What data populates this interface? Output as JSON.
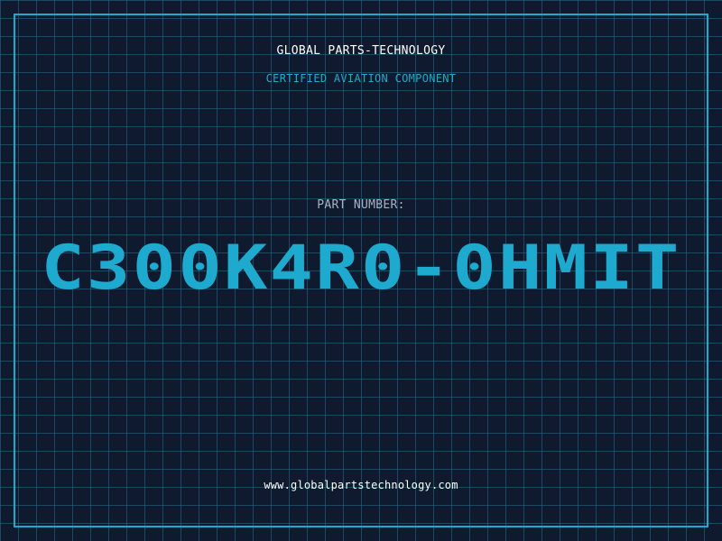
{
  "header": {
    "company": "GLOBAL PARTS-TECHNOLOGY",
    "subtitle": "CERTIFIED AVIATION COMPONENT"
  },
  "part": {
    "label": "PART NUMBER:",
    "number": "C300K4R0-0HMIT"
  },
  "footer": {
    "website": "www.globalpartstechnology.com"
  },
  "colors": {
    "background": "#0f1a2e",
    "accent": "#1eaacf",
    "grid": "#286e8c",
    "label": "#a6b3c4",
    "text": "#ffffff"
  }
}
